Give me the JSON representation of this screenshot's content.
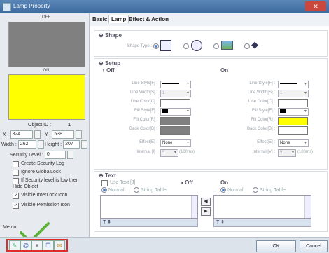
{
  "window": {
    "title": "Lamp Property",
    "close_glyph": "✕"
  },
  "tabs": [
    "Basic",
    "Lamp",
    "Effect & Action"
  ],
  "preview": {
    "off_label": "OFF",
    "on_label": "ON",
    "off_color": "#808080",
    "on_color": "#ffff00"
  },
  "object": {
    "id_label": "Object ID :",
    "id_value": "1",
    "x_label": "X :",
    "x_value": "324",
    "y_label": "Y :",
    "y_value": "538",
    "width_label": "Width :",
    "width_value": "262",
    "height_label": "Height :",
    "height_value": "207",
    "security_label": "Security Level :",
    "security_value": "0"
  },
  "options": [
    {
      "label": "Create Security Log",
      "checked": false
    },
    {
      "label": "Ignore GlobalLock",
      "checked": false
    },
    {
      "label": "If Security level is low then Hide Object",
      "checked": false
    },
    {
      "label": "Visible InterLock Icon",
      "checked": true
    },
    {
      "label": "Visible Pemission Icon",
      "checked": true
    }
  ],
  "memo_label": "Memo :",
  "shape": {
    "header": "Shape",
    "type_label": "Shape Type :"
  },
  "setup": {
    "header": "Setup",
    "off_label": "Off",
    "on_label": "On",
    "labels": [
      "Line Style[F] :",
      "Line Width[S] :",
      "Line Color[C] :",
      "Fill Style[F] :",
      "Fill Color[R] :",
      "Back Color[B] :"
    ],
    "width_value": "1",
    "effect_label": "Effect[E] :",
    "effect_value": "None",
    "interval_label": "Interval [I] :",
    "interval_value": "5",
    "interval_unit": "(100ms)",
    "on_effect_label": "Effect[E] :",
    "on_interval_label": "Interval [V] :"
  },
  "text_section": {
    "header": "Text",
    "use_text": "Use Text [J]",
    "off_label": "Off",
    "on_label": "On",
    "normal": "Normal",
    "string_table": "String Table"
  },
  "buttons": {
    "ok": "OK",
    "cancel": "Cancel"
  },
  "colors": {
    "accent": "#3d6a9e",
    "highlight": "#e02b2b",
    "check": "#5db33a"
  }
}
